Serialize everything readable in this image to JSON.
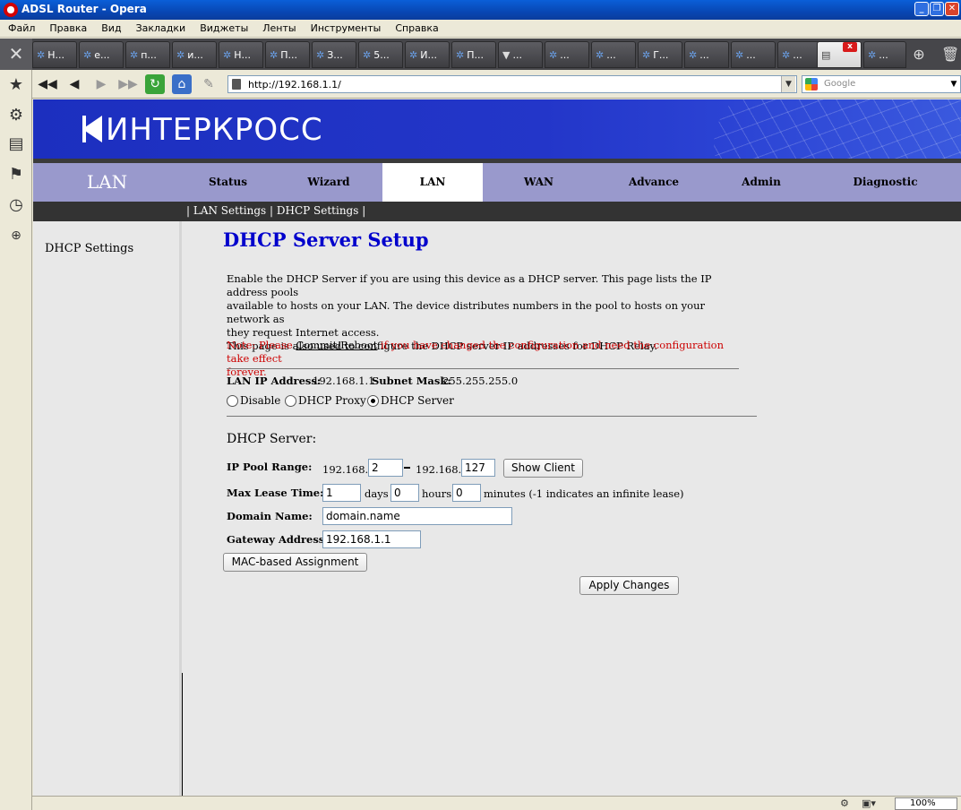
{
  "window": {
    "title": "ADSL Router - Opera"
  },
  "menu": [
    "Файл",
    "Правка",
    "Вид",
    "Закладки",
    "Виджеты",
    "Ленты",
    "Инструменты",
    "Справка"
  ],
  "tabs": [
    "Н...",
    "е...",
    "п...",
    "и...",
    "Н...",
    "П...",
    "З...",
    "5...",
    "И...",
    "П...",
    "...",
    "...",
    "...",
    "Г...",
    "...",
    "...",
    "...",
    "",
    "..."
  ],
  "address": {
    "url": "http://192.168.1.1/",
    "search_placeholder": "Google"
  },
  "brand": "ИНТЕРКРОСС",
  "nav": {
    "section": "LAN",
    "items": [
      "Status",
      "Wizard",
      "LAN",
      "WAN",
      "Advance",
      "Admin",
      "Diagnostic"
    ],
    "active": "LAN"
  },
  "subnav": "| LAN Settings | DHCP Settings |",
  "sidebar": {
    "item": "DHCP Settings"
  },
  "content": {
    "title": "DHCP Server Setup",
    "description_lines": [
      "Enable the DHCP Server if you are using this device as a DHCP server. This page lists the IP address pools",
      "available to hosts on your LAN. The device distributes numbers in the pool to hosts on your network as",
      "they request Internet access.",
      "This page is also used to configure the DHCP server IP addresses for DHCP Relay."
    ],
    "note_prefix": "Note: Please ",
    "note_link": "Commit/Reboot",
    "note_suffix": " if you have changed the configuration and need the configuration take effect",
    "note_line2": "forever.",
    "lan_ip_label": "LAN IP Address:",
    "lan_ip_value": "192.168.1.1",
    "subnet_label": "Subnet Mask:",
    "subnet_value": "255.255.255.0",
    "mode_options": [
      "Disable",
      "DHCP Proxy",
      "DHCP Server"
    ],
    "mode_selected": "DHCP Server",
    "section_title": "DHCP Server:",
    "ip_pool_label": "IP Pool Range:",
    "ip_prefix_start": "192.168.1.",
    "ip_start": "2",
    "ip_prefix_end": "192.168.1.",
    "ip_end": "127",
    "show_client_label": "Show Client",
    "max_lease_label": "Max Lease Time:",
    "lease_days": "1",
    "days_label": "days",
    "lease_hours": "0",
    "hours_label": "hours",
    "lease_minutes": "0",
    "minutes_label": "minutes (-1 indicates an infinite lease)",
    "domain_label": "Domain Name:",
    "domain_value": "domain.name",
    "gateway_label": "Gateway Address:",
    "gateway_value": "192.168.1.1",
    "mac_button_label": "MAC-based Assignment",
    "apply_button_label": "Apply Changes"
  },
  "statusbar": {
    "zoom": "100%"
  }
}
